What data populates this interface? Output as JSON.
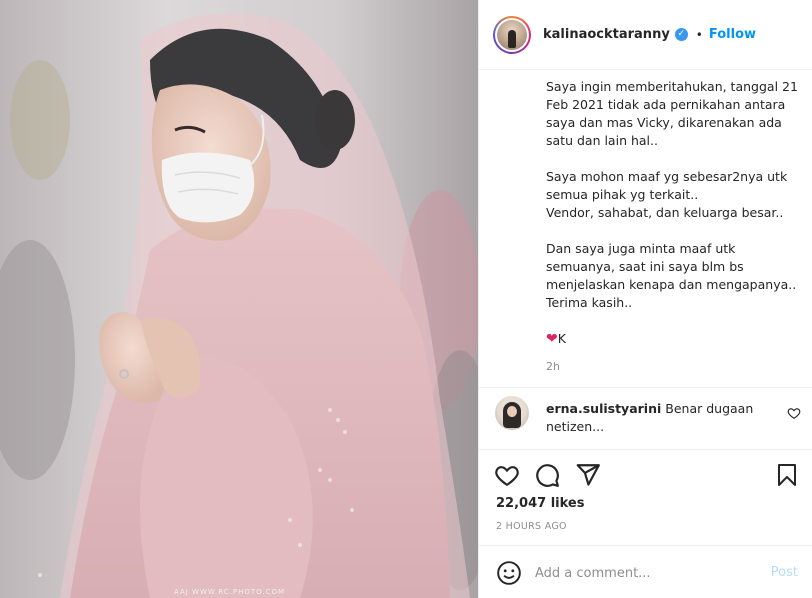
{
  "post": {
    "username": "kalinaocktaranny",
    "verified": true,
    "dot": "•",
    "follow_label": "Follow",
    "caption_p1": "Saya ingin memberitahukan, tanggal 21 Feb 2021 tidak ada pernikahan antara saya dan mas Vicky, dikarenakan ada satu dan lain hal..",
    "caption_p2": "Saya mohon maaf yg sebesar2nya utk semua pihak yg terkait..\nVendor, sahabat, dan keluarga besar..",
    "caption_p3": "Dan saya juga minta maaf utk semuanya, saat ini saya blm bs menjelaskan kenapa dan mengapanya..\nTerima kasih..",
    "caption_sign_heart": "❤",
    "caption_sign": "K",
    "time_ago": "2h",
    "photo_watermark": "AAJ  WWW.RC.PHOTO.COM"
  },
  "comment": {
    "username": "erna.sulistyarini",
    "text": "Benar dugaan netizen..."
  },
  "actions": {
    "likes": "22,047 likes",
    "timestamp": "2 HOURS AGO"
  },
  "add_comment": {
    "placeholder": "Add a comment...",
    "post_label": "Post"
  },
  "icons": {
    "verified": "verified-badge-icon",
    "heart": "heart-icon",
    "comment": "comment-icon",
    "share": "share-icon",
    "bookmark": "bookmark-icon",
    "emoji": "emoji-icon"
  },
  "colors": {
    "accent": "#0095f6",
    "post_disabled": "#b2dffc",
    "muted": "#8e8e8e",
    "heart_red": "#e0245e"
  }
}
